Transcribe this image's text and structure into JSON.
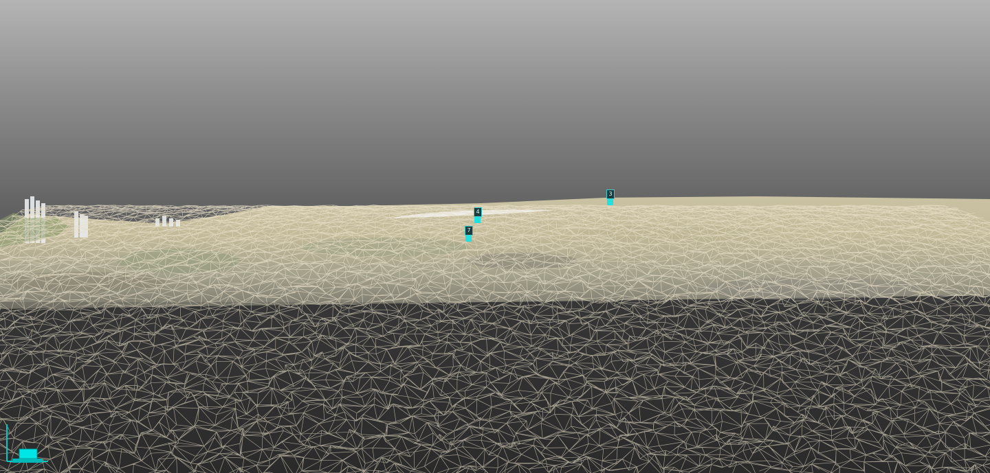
{
  "viewer": {
    "sky_top_color": "#b4b4b4",
    "sky_horizon_color": "#5e5e5e",
    "ground_color": "#2b2b2b",
    "terrain_color": "#d6cca8",
    "wireframe_color": "#e8e0cc",
    "marker_color": "#20e0e0"
  },
  "markers": [
    {
      "label": "3",
      "icon": "gcp-marker-icon"
    },
    {
      "label": "4",
      "icon": "gcp-marker-icon"
    },
    {
      "label": "7",
      "icon": "gcp-marker-icon"
    }
  ],
  "axis_gizmo": {
    "icon": "axis-gizmo-icon",
    "color": "#00e5e5"
  }
}
